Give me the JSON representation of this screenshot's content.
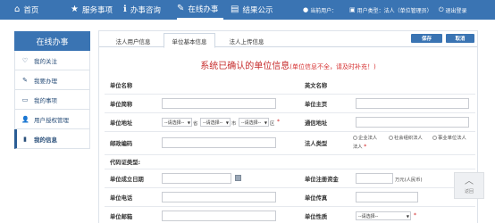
{
  "nav": {
    "items": [
      {
        "label": "首页",
        "icon": "home-icon",
        "glyph": "⌂"
      },
      {
        "label": "服务事项",
        "icon": "star-icon",
        "glyph": "★"
      },
      {
        "label": "办事咨询",
        "icon": "info-icon",
        "glyph": "ℹ"
      },
      {
        "label": "在线办事",
        "icon": "pencil-icon",
        "glyph": "✎"
      },
      {
        "label": "结果公示",
        "icon": "document-icon",
        "glyph": "▤"
      }
    ],
    "current_user": "当前用户：",
    "user_type": "用户类型：法人（单位管理员）",
    "logout": "退出登录"
  },
  "sidebar": {
    "title": "在线办事",
    "items": [
      {
        "label": "我的关注",
        "glyph": "♡"
      },
      {
        "label": "我要办理",
        "glyph": "✎"
      },
      {
        "label": "我的事项",
        "glyph": "▭"
      },
      {
        "label": "用户授权管理",
        "glyph": "👤"
      },
      {
        "label": "我的信息",
        "glyph": "▮"
      }
    ]
  },
  "tabs": [
    "法人用户信息",
    "单位基本信息",
    "法人上传信息"
  ],
  "buttons": {
    "save": "保存",
    "cancel": "取消"
  },
  "title": {
    "main": "系统已确认的单位信息",
    "note": "(单位信息不全，请及时补充！)"
  },
  "form": {
    "unit_name": "单位名称",
    "english_name": "英文名称",
    "unit_short": "单位简称",
    "unit_homepage": "单位主页",
    "unit_address": "单位地址",
    "province_select": "--请选择--",
    "province_unit": "省",
    "city_select": "--请选择--",
    "city_unit": "市",
    "district_select": "--请选择--",
    "district_unit": "区",
    "comm_address": "通信地址",
    "postal_code": "邮政编码",
    "legal_type": "法人类型",
    "legal_opt1": "企业法人",
    "legal_opt2": "社会组织法人",
    "legal_opt3": "事业单位法人",
    "code_type": "代码证类型:",
    "found_date": "单位成立日期",
    "reg_capital": "单位注册资金",
    "capital_unit": "万元(人民币)",
    "unit_phone": "单位电话",
    "unit_fax": "单位传真",
    "unit_email": "单位邮箱",
    "unit_nature": "单位性质",
    "nature_select": "--请选择--",
    "required": "*"
  },
  "back_top": "返回"
}
